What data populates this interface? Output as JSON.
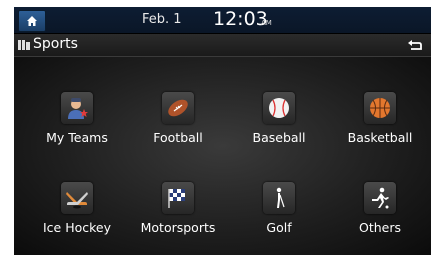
{
  "statusbar": {
    "date": "Feb.  1",
    "time": "12:03",
    "ampm": "AM"
  },
  "header": {
    "title": "Sports"
  },
  "categories": [
    {
      "label": "My Teams",
      "icon": "my-teams-icon"
    },
    {
      "label": "Football",
      "icon": "football-icon"
    },
    {
      "label": "Baseball",
      "icon": "baseball-icon"
    },
    {
      "label": "Basketball",
      "icon": "basketball-icon"
    },
    {
      "label": "Ice Hockey",
      "icon": "ice-hockey-icon"
    },
    {
      "label": "Motorsports",
      "icon": "motorsports-icon"
    },
    {
      "label": "Golf",
      "icon": "golf-icon"
    },
    {
      "label": "Others",
      "icon": "others-icon"
    }
  ]
}
